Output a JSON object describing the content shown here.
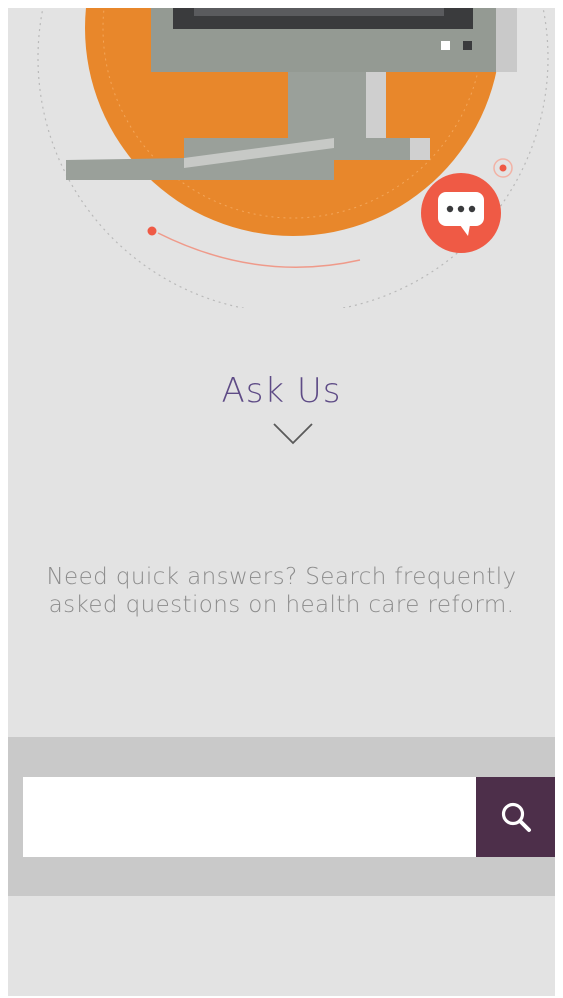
{
  "ask": {
    "title": "Ask Us"
  },
  "description": "Need quick answers? Search frequently asked questions on health care reform.",
  "search": {
    "value": "",
    "placeholder": ""
  },
  "colors": {
    "accent_purple": "#5e4b86",
    "search_button": "#4d2f4a",
    "orange": "#e8872b",
    "chat_red": "#ef5a45",
    "background": "#e3e3e3"
  },
  "icons": {
    "hero": "computer-monitor-illustration",
    "chat": "chat-bubble-icon",
    "chevron": "chevron-down-icon",
    "search": "search-icon"
  }
}
